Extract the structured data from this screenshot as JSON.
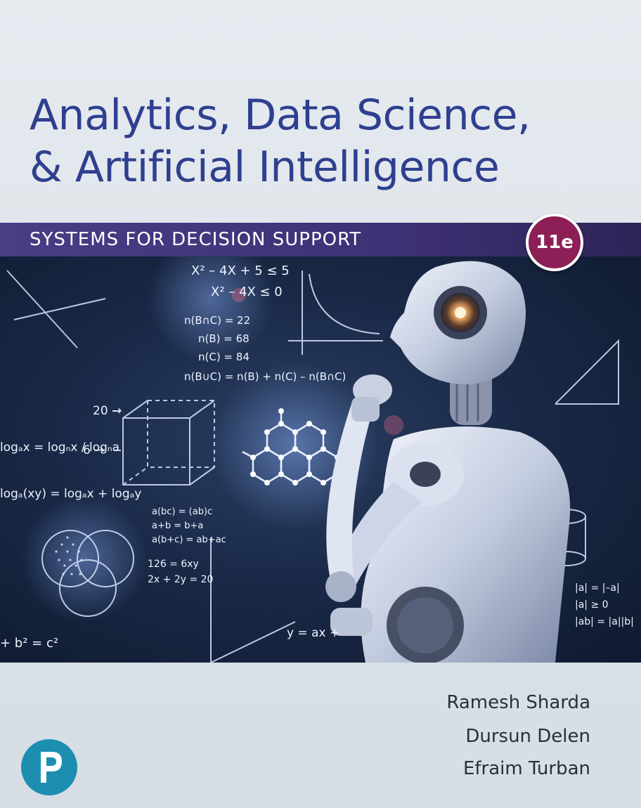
{
  "cover": {
    "title_line_1": "Analytics, Data Science,",
    "title_line_2": "& Artificial Intelligence",
    "subtitle": "SYSTEMS FOR DECISION SUPPORT",
    "edition": "11e",
    "authors": [
      "Ramesh Sharda",
      "Dursun Delen",
      "Efraim Turban"
    ],
    "publisher_logo_icon": "pearson-p-logo-icon",
    "illustration_icon": "robot-thinking-with-math-formulas-illustration",
    "formula_texts": [
      "X² – 4X + 5 ≤ 5",
      "X² – 4X ≤ 0",
      "n(B∩C) = 22",
      "n(B) = 68",
      "n(C) = 84",
      "n(B∪C) = n(B) + n(C) – n(B∩C)",
      "a(bc) = (ab)c",
      "a+b = b+a",
      "a(b+c) = ab+ac",
      "126 = 6xy",
      "2x + 2y = 20",
      "y = ax +",
      "|a| = |–a|",
      "|a| ≥ 0",
      "|ab| = |a||b|",
      "logₐx = logₙx / logₙa",
      "logₐ(xy) = logₐx + logₐy",
      "+ b² = c²",
      "20 →",
      "6 →"
    ]
  },
  "colors": {
    "title": "#2f3f8f",
    "subtitle_band": "#44377f",
    "subtitle_text": "#ffffff",
    "edition_badge": "#8c1f56",
    "author_text": "#2a2f3a",
    "publisher_logo": "#1c8fb0",
    "art_background": "#1a2947"
  }
}
